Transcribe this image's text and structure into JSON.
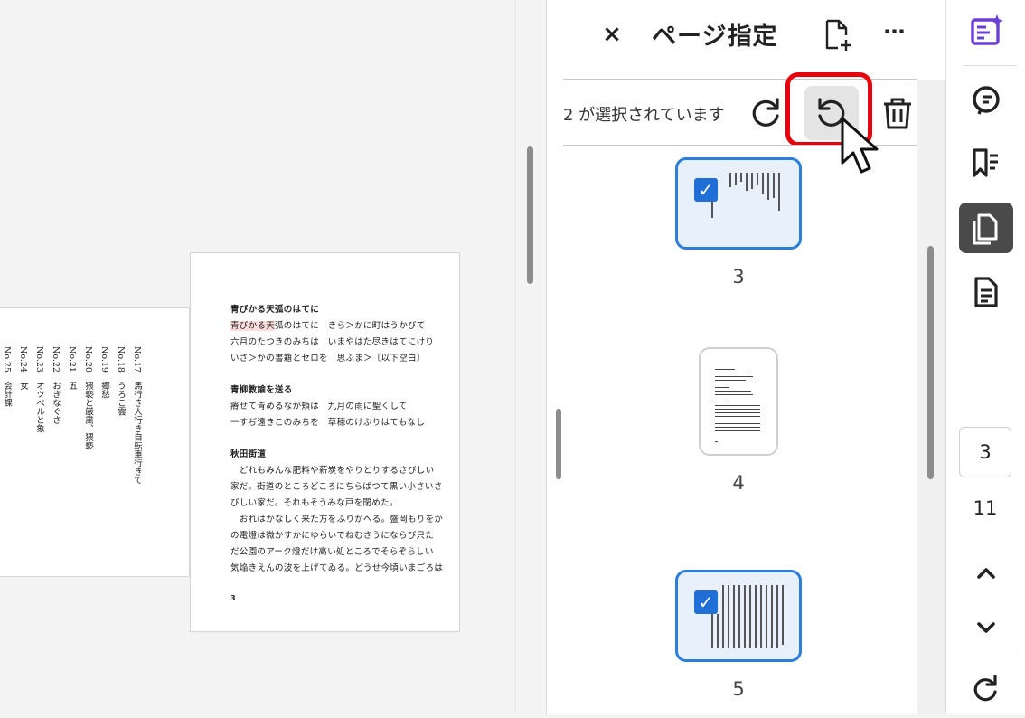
{
  "document": {
    "left_page_columns": [
      "No.17　馬行き人行き自転車行きて",
      "No.18　うろこ雲",
      "No.19　郷愁",
      "No.20　猥褻と厳粛、猥褻",
      "No.21　五",
      "No.22　おきなぐさ",
      "No.23　オツベルと象",
      "No.24　女",
      "No.25　会計課"
    ],
    "right_page": {
      "lines": [
        {
          "text": "青びかる天弧のはてに",
          "head": true
        },
        {
          "text": "青びかる天弧のはてに　きら＞かに町はうかびて",
          "head": false
        },
        {
          "text": "六月のたつきのみちは　いまやはた尽きはてにけり",
          "head": false
        },
        {
          "text": "いさ＞かの書籍とセロを　思ふま＞〔以下空白〕",
          "head": false
        },
        {
          "text": "青柳教諭を送る",
          "head": true
        },
        {
          "text": "瘠せて青めるなが頬は　九月の雨に聖くして",
          "head": false
        },
        {
          "text": "一すぢ遠きこのみちを　草穂のけぶりはてもなし",
          "head": false
        },
        {
          "text": "秋田街道",
          "head": true
        },
        {
          "text": "　どれもみんな肥料や薪炭をやりとりするさびしい",
          "head": false
        },
        {
          "text": "家だ。街道のところどころにちらばつて黒い小さいさ",
          "head": false
        },
        {
          "text": "びしい家だ。それもそうみな戸を閉めた。",
          "head": false
        },
        {
          "text": "　おれはかなしく来た方をふりかへる。盛岡もりをか",
          "head": false
        },
        {
          "text": "の電燈は微かすかにゆらいでねむさうにならび只た",
          "head": false
        },
        {
          "text": "だ公園のアーク燈だけ高い処ところでそらぞらしい",
          "head": false
        },
        {
          "text": "気焔きえんの波を上げてゐる。どうせ今頃いまごろは",
          "head": false
        }
      ],
      "page_number": "3"
    }
  },
  "panel": {
    "title": "ページ指定",
    "close_icon": "×",
    "more_icon": "⋯",
    "selection_text": "2 が選択されています",
    "thumbnails": [
      {
        "page": "3",
        "selected": true
      },
      {
        "page": "4",
        "selected": false
      },
      {
        "page": "5",
        "selected": true
      }
    ]
  },
  "rail": {
    "current_page": "3",
    "total_pages": "11"
  },
  "colors": {
    "accent_blue": "#2b7fdb",
    "highlight_red": "#e8000b",
    "rail_active": "#4a4a4a",
    "ai_purple": "#6b3fd4"
  }
}
